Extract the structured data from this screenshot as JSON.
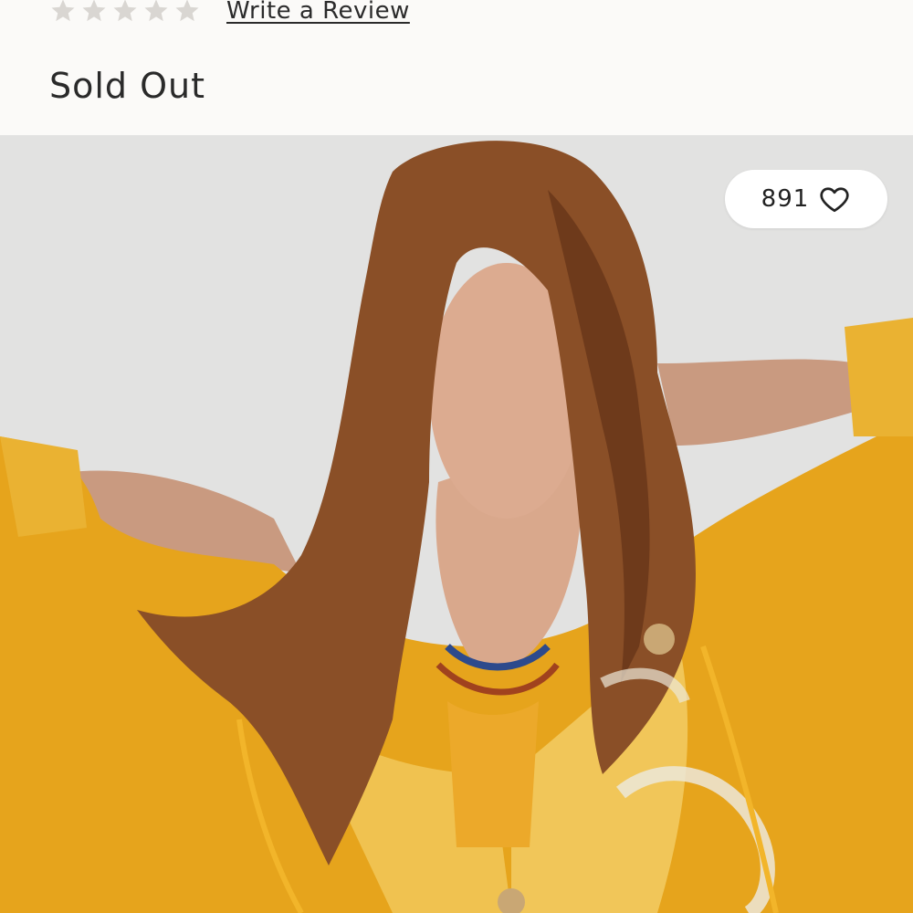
{
  "product": {
    "rating_stars": 5,
    "review_link_label": "Write a Review",
    "availability": "Sold Out"
  },
  "gallery": {
    "favorites_count": "891",
    "favorite_icon": "heart-outline-icon",
    "star_icon": "star-icon"
  },
  "colors": {
    "star_empty": "#d9d6d2",
    "page_background": "#fbfaf8",
    "sweater_yellow": "#e9a91c"
  }
}
